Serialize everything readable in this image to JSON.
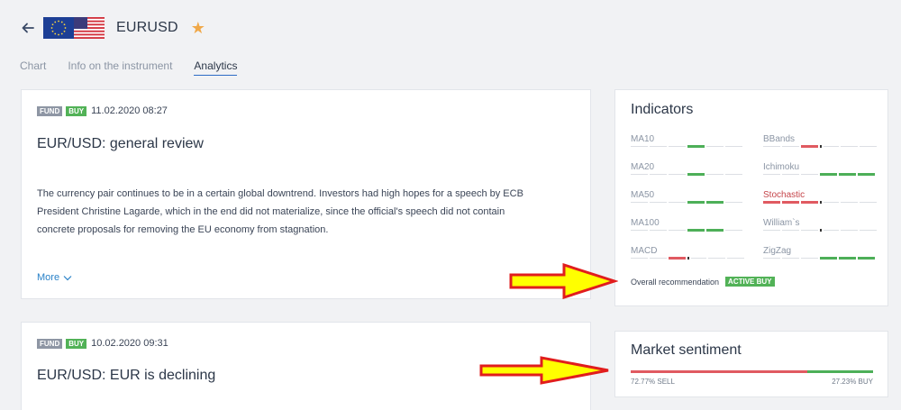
{
  "header": {
    "title": "EURUSD",
    "back_icon": "arrow-left-icon",
    "star_icon": "star-icon",
    "star_color": "#f0a848"
  },
  "tabs": [
    {
      "label": "Chart",
      "active": false
    },
    {
      "label": "Info on the instrument",
      "active": false
    },
    {
      "label": "Analytics",
      "active": true
    }
  ],
  "articles": [
    {
      "badges": [
        "FUND",
        "BUY"
      ],
      "date": "11.02.2020 08:27",
      "title": "EUR/USD: general review",
      "body": [
        "The currency pair continues to be in a certain global downtrend. Investors had high hopes for a speech by ECB",
        "President Christine Lagarde, which in the end did not materialize, since the official's speech did not contain",
        "concrete proposals for removing the EU economy from stagnation."
      ],
      "more_label": "More"
    },
    {
      "badges": [
        "FUND",
        "BUY"
      ],
      "date": "10.02.2020 09:31",
      "title": "EUR/USD: EUR is declining"
    }
  ],
  "indicators": {
    "title": "Indicators",
    "left": [
      {
        "name": "MA10",
        "segments": [
          "",
          "",
          "",
          "g",
          "",
          ""
        ]
      },
      {
        "name": "MA20",
        "segments": [
          "",
          "",
          "",
          "g",
          "",
          ""
        ]
      },
      {
        "name": "MA50",
        "segments": [
          "",
          "",
          "",
          "g",
          "g",
          ""
        ]
      },
      {
        "name": "MA100",
        "segments": [
          "",
          "",
          "",
          "g",
          "g",
          ""
        ]
      },
      {
        "name": "MACD",
        "segments": [
          "",
          "",
          "r",
          "k",
          "",
          ""
        ]
      }
    ],
    "right": [
      {
        "name": "BBands",
        "segments": [
          "",
          "",
          "r",
          "k",
          "",
          ""
        ]
      },
      {
        "name": "Ichimoku",
        "segments": [
          "",
          "",
          "",
          "g",
          "g",
          "g"
        ]
      },
      {
        "name": "Stochastic",
        "negative": true,
        "segments": [
          "r",
          "r",
          "r",
          "k",
          "",
          ""
        ]
      },
      {
        "name": "William`s",
        "segments": [
          "",
          "",
          "",
          "k",
          "",
          ""
        ]
      },
      {
        "name": "ZigZag",
        "segments": [
          "",
          "",
          "",
          "g",
          "g",
          "g"
        ]
      }
    ],
    "overall_label": "Overall recommendation",
    "overall_value": "ACTIVE BUY"
  },
  "sentiment": {
    "title": "Market sentiment",
    "sell_percent": 72.77,
    "buy_percent": 27.23,
    "sell_label": "72.77% SELL",
    "buy_label": "27.23% BUY",
    "sell_color": "#e05a61",
    "buy_color": "#4daf58"
  },
  "annotation_arrows": {
    "color_fill": "#ffff00",
    "color_stroke": "#e11d1d",
    "count": 2
  }
}
